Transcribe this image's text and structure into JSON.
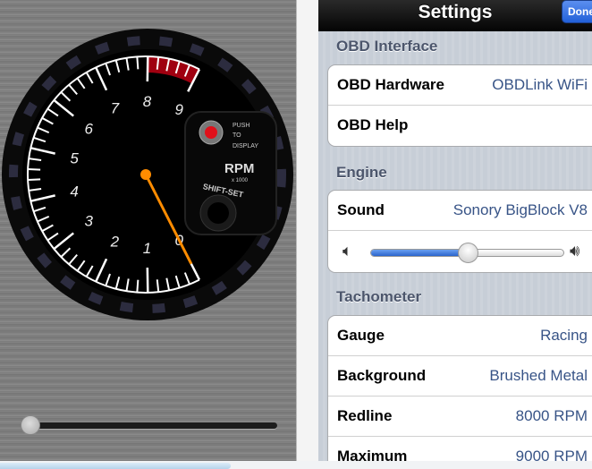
{
  "gauge": {
    "min": 0,
    "max": 9,
    "redline_start": 8,
    "value_rpm": 0,
    "labels": [
      "0",
      "1",
      "2",
      "3",
      "4",
      "5",
      "6",
      "7",
      "8",
      "9"
    ],
    "unit": "RPM",
    "multiplier": "x 1000",
    "button_text": [
      "PUSH",
      "TO",
      "DISPLAY"
    ],
    "knob_text": "SHIFT-SET",
    "colors": {
      "needle": "#ff8c00",
      "redzone": "#a00010",
      "button": "#e0101a"
    }
  },
  "left_slider": {
    "value": 0
  },
  "settings": {
    "title": "Settings",
    "done_label": "Done",
    "sections": [
      {
        "header": "OBD Interface",
        "rows": [
          {
            "label": "OBD Hardware",
            "value": "OBDLink WiFi"
          },
          {
            "label": "OBD Help",
            "value": ""
          }
        ]
      },
      {
        "header": "Engine",
        "rows": [
          {
            "label": "Sound",
            "value": "Sonory BigBlock V8"
          }
        ],
        "volume": 0.5
      },
      {
        "header": "Tachometer",
        "rows": [
          {
            "label": "Gauge",
            "value": "Racing"
          },
          {
            "label": "Background",
            "value": "Brushed Metal"
          },
          {
            "label": "Redline",
            "value": "8000 RPM"
          },
          {
            "label": "Maximum",
            "value": "9000 RPM"
          }
        ]
      }
    ],
    "colors": {
      "value_text": "#385487",
      "accent": "#2a64cc"
    }
  },
  "scroll": {
    "horizontal_fraction": 0.39
  }
}
